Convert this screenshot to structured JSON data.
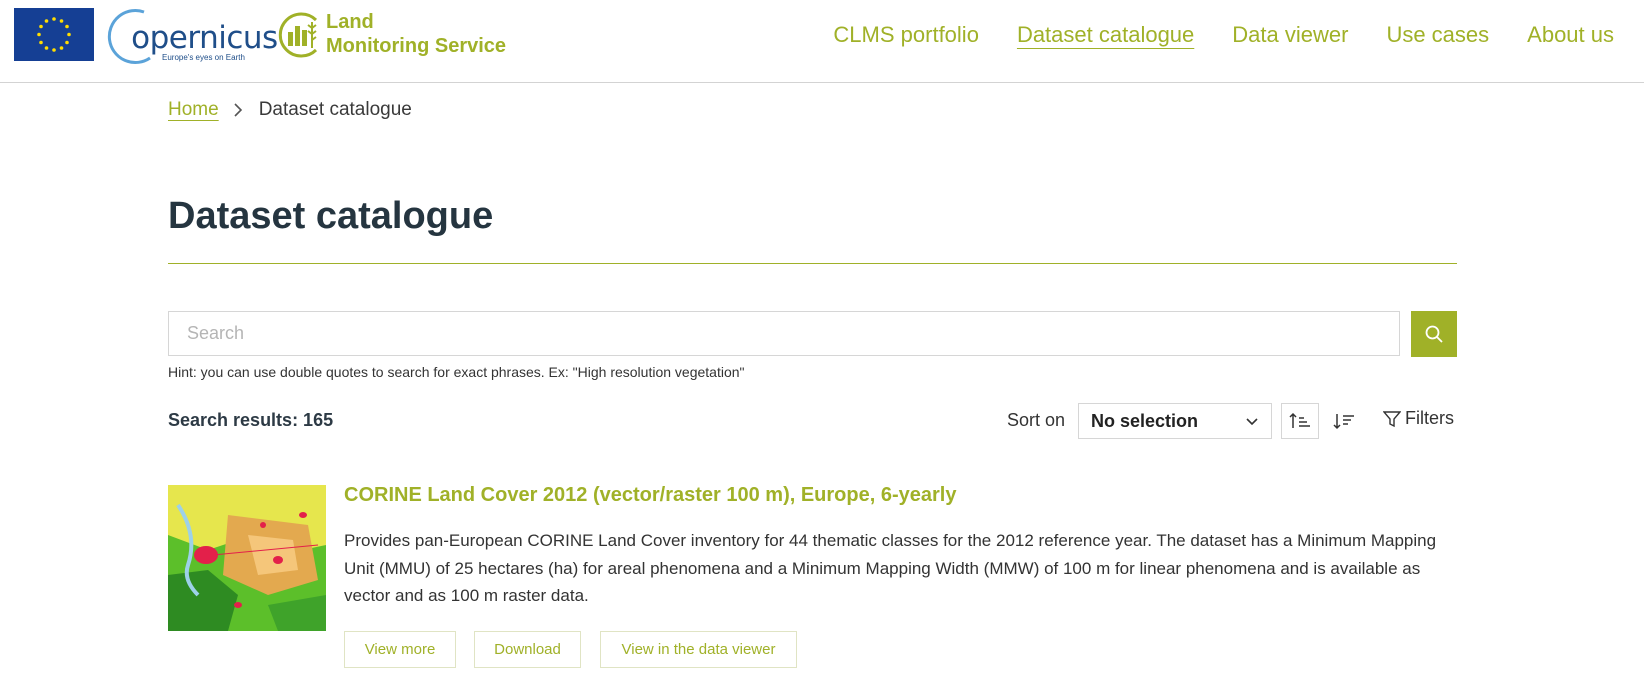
{
  "header": {
    "brand_name": "opernicus",
    "brand_letter": "C",
    "brand_tagline": "Europe's eyes on Earth",
    "service_line1": "Land",
    "service_line2": "Monitoring Service",
    "nav": [
      {
        "label": "CLMS portfolio",
        "active": false
      },
      {
        "label": "Dataset catalogue",
        "active": true
      },
      {
        "label": "Data viewer",
        "active": false
      },
      {
        "label": "Use cases",
        "active": false
      },
      {
        "label": "About us",
        "active": false
      }
    ]
  },
  "breadcrumb": {
    "home": "Home",
    "current": "Dataset catalogue"
  },
  "page_title": "Dataset catalogue",
  "search": {
    "placeholder": "Search",
    "value": "",
    "hint": "Hint: you can use double quotes to search for exact phrases. Ex: \"High resolution vegetation\""
  },
  "results_bar": {
    "count_text": "Search results: 165",
    "sort_label": "Sort on",
    "sort_value": "No selection",
    "filters_label": "Filters"
  },
  "results": [
    {
      "title": "CORINE Land Cover 2012 (vector/raster 100 m), Europe, 6-yearly",
      "description": "Provides pan-European CORINE Land Cover inventory for 44 thematic classes for the 2012 reference year. The dataset has a Minimum Mapping Unit (MMU) of 25 hectares (ha) for areal phenomena and a Minimum Mapping Width (MMW) of 100 m for linear phenomena and is available as vector and as 100 m raster data.",
      "buttons": {
        "view_more": "View more",
        "download": "Download",
        "view_in_viewer": "View in the data viewer"
      }
    }
  ],
  "colors": {
    "accent": "#a0b128",
    "eu_blue": "#153f94",
    "eu_stars": "#ffdd00",
    "copernicus_blue": "#1f4e89",
    "heading": "#253540"
  },
  "icons": {
    "search": "search-icon",
    "breadcrumb_separator": "chevron-right-icon",
    "sort_dropdown": "chevron-down-icon",
    "sort_ascending": "sort-ascending-icon",
    "sort_descending": "sort-descending-icon",
    "filters": "filter-icon"
  }
}
